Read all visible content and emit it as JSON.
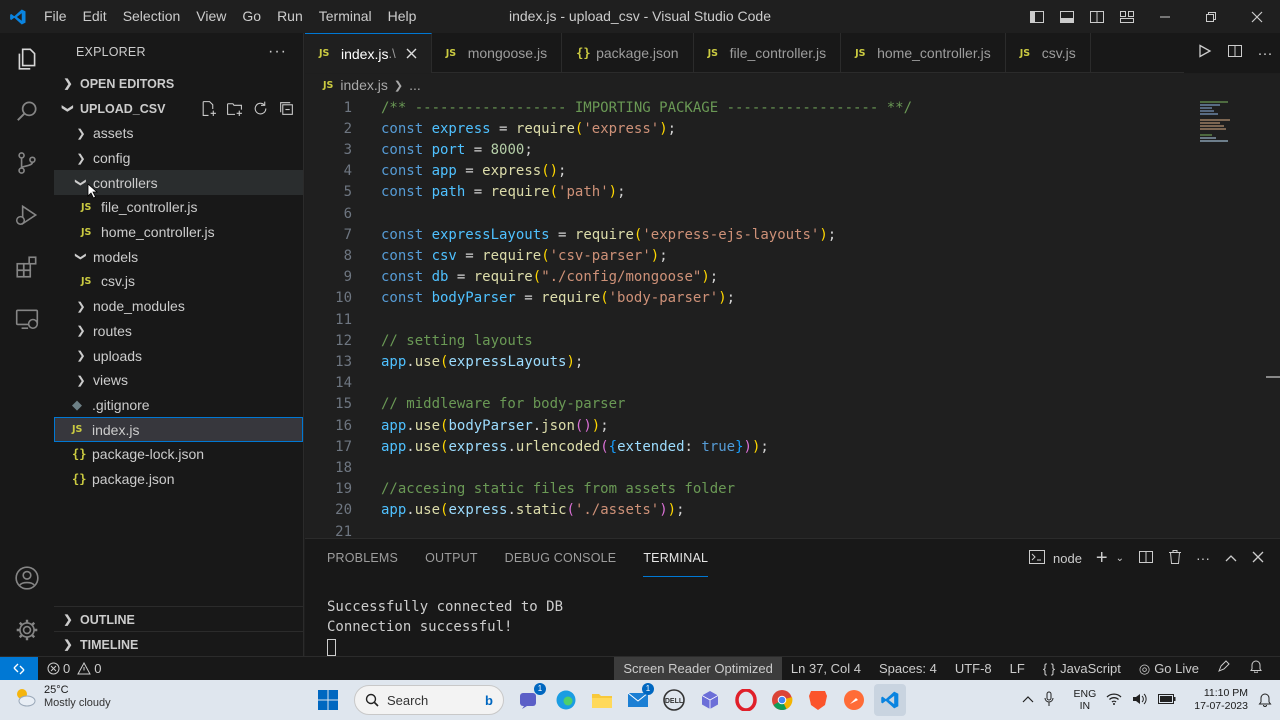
{
  "window": {
    "title": "index.js - upload_csv - Visual Studio Code",
    "menu": [
      "File",
      "Edit",
      "Selection",
      "View",
      "Go",
      "Run",
      "Terminal",
      "Help"
    ]
  },
  "explorer": {
    "header": "EXPLORER",
    "more": "···",
    "open_editors": "OPEN EDITORS",
    "project": "UPLOAD_CSV",
    "tree": [
      {
        "label": "assets",
        "type": "folder",
        "expanded": false,
        "depth": 0
      },
      {
        "label": "config",
        "type": "folder",
        "expanded": false,
        "depth": 0
      },
      {
        "label": "controllers",
        "type": "folder",
        "expanded": true,
        "depth": 0
      },
      {
        "label": "file_controller.js",
        "type": "js",
        "depth": 1
      },
      {
        "label": "home_controller.js",
        "type": "js",
        "depth": 1
      },
      {
        "label": "models",
        "type": "folder",
        "expanded": true,
        "depth": 0
      },
      {
        "label": "csv.js",
        "type": "js",
        "depth": 1
      },
      {
        "label": "node_modules",
        "type": "folder",
        "expanded": false,
        "depth": 0
      },
      {
        "label": "routes",
        "type": "folder",
        "expanded": false,
        "depth": 0
      },
      {
        "label": "uploads",
        "type": "folder",
        "expanded": false,
        "depth": 0
      },
      {
        "label": "views",
        "type": "folder",
        "expanded": false,
        "depth": 0
      },
      {
        "label": ".gitignore",
        "type": "git",
        "depth": 0
      },
      {
        "label": "index.js",
        "type": "js",
        "depth": 0,
        "selected": true
      },
      {
        "label": "package-lock.json",
        "type": "json",
        "depth": 0
      },
      {
        "label": "package.json",
        "type": "json",
        "depth": 0
      }
    ],
    "outline": "OUTLINE",
    "timeline": "TIMELINE"
  },
  "tabs": [
    {
      "label": "index.js",
      "suffix": " .\\",
      "icon": "JS",
      "active": true
    },
    {
      "label": "mongoose.js",
      "icon": "JS"
    },
    {
      "label": "package.json",
      "icon": "{}"
    },
    {
      "label": "file_controller.js",
      "icon": "JS"
    },
    {
      "label": "home_controller.js",
      "icon": "JS"
    },
    {
      "label": "csv.js",
      "icon": "JS"
    }
  ],
  "breadcrumb": {
    "file": "index.js",
    "rest": "..."
  },
  "code": [
    {
      "n": "1",
      "segs": [
        [
          "/** ------------------ IMPORTING PACKAGE ------------------ **/",
          "#6a9955"
        ]
      ]
    },
    {
      "n": "2",
      "segs": [
        [
          "const ",
          "#569cd6"
        ],
        [
          "express",
          "#4fc1ff"
        ],
        [
          " = ",
          "#d4d4d4"
        ],
        [
          "require",
          "#dcdcaa"
        ],
        [
          "(",
          "#ffd700"
        ],
        [
          "'express'",
          "#ce9178"
        ],
        [
          ")",
          "#ffd700"
        ],
        [
          ";",
          "#d4d4d4"
        ]
      ]
    },
    {
      "n": "3",
      "segs": [
        [
          "const ",
          "#569cd6"
        ],
        [
          "port",
          "#4fc1ff"
        ],
        [
          " = ",
          "#d4d4d4"
        ],
        [
          "8000",
          "#b5cea8"
        ],
        [
          ";",
          "#d4d4d4"
        ]
      ]
    },
    {
      "n": "4",
      "segs": [
        [
          "const ",
          "#569cd6"
        ],
        [
          "app",
          "#4fc1ff"
        ],
        [
          " = ",
          "#d4d4d4"
        ],
        [
          "express",
          "#dcdcaa"
        ],
        [
          "()",
          "#ffd700"
        ],
        [
          ";",
          "#d4d4d4"
        ]
      ]
    },
    {
      "n": "5",
      "segs": [
        [
          "const ",
          "#569cd6"
        ],
        [
          "path",
          "#4fc1ff"
        ],
        [
          " = ",
          "#d4d4d4"
        ],
        [
          "require",
          "#dcdcaa"
        ],
        [
          "(",
          "#ffd700"
        ],
        [
          "'path'",
          "#ce9178"
        ],
        [
          ")",
          "#ffd700"
        ],
        [
          ";",
          "#d4d4d4"
        ]
      ]
    },
    {
      "n": "6",
      "segs": []
    },
    {
      "n": "7",
      "segs": [
        [
          "const ",
          "#569cd6"
        ],
        [
          "expressLayouts",
          "#4fc1ff"
        ],
        [
          " = ",
          "#d4d4d4"
        ],
        [
          "require",
          "#dcdcaa"
        ],
        [
          "(",
          "#ffd700"
        ],
        [
          "'express-ejs-layouts'",
          "#ce9178"
        ],
        [
          ")",
          "#ffd700"
        ],
        [
          ";",
          "#d4d4d4"
        ]
      ]
    },
    {
      "n": "8",
      "segs": [
        [
          "const ",
          "#569cd6"
        ],
        [
          "csv",
          "#4fc1ff"
        ],
        [
          " = ",
          "#d4d4d4"
        ],
        [
          "require",
          "#dcdcaa"
        ],
        [
          "(",
          "#ffd700"
        ],
        [
          "'csv-parser'",
          "#ce9178"
        ],
        [
          ")",
          "#ffd700"
        ],
        [
          ";",
          "#d4d4d4"
        ]
      ]
    },
    {
      "n": "9",
      "segs": [
        [
          "const ",
          "#569cd6"
        ],
        [
          "db",
          "#4fc1ff"
        ],
        [
          " = ",
          "#d4d4d4"
        ],
        [
          "require",
          "#dcdcaa"
        ],
        [
          "(",
          "#ffd700"
        ],
        [
          "\"./config/mongoose\"",
          "#ce9178"
        ],
        [
          ")",
          "#ffd700"
        ],
        [
          ";",
          "#d4d4d4"
        ]
      ]
    },
    {
      "n": "10",
      "segs": [
        [
          "const ",
          "#569cd6"
        ],
        [
          "bodyParser",
          "#4fc1ff"
        ],
        [
          " = ",
          "#d4d4d4"
        ],
        [
          "require",
          "#dcdcaa"
        ],
        [
          "(",
          "#ffd700"
        ],
        [
          "'body-parser'",
          "#ce9178"
        ],
        [
          ")",
          "#ffd700"
        ],
        [
          ";",
          "#d4d4d4"
        ]
      ]
    },
    {
      "n": "11",
      "segs": []
    },
    {
      "n": "12",
      "segs": [
        [
          "// setting layouts",
          "#6a9955"
        ]
      ]
    },
    {
      "n": "13",
      "segs": [
        [
          "app",
          "#4fc1ff"
        ],
        [
          ".",
          "#d4d4d4"
        ],
        [
          "use",
          "#dcdcaa"
        ],
        [
          "(",
          "#ffd700"
        ],
        [
          "expressLayouts",
          "#9cdcfe"
        ],
        [
          ")",
          "#ffd700"
        ],
        [
          ";",
          "#d4d4d4"
        ]
      ]
    },
    {
      "n": "14",
      "segs": []
    },
    {
      "n": "15",
      "segs": [
        [
          "// middleware for body-parser",
          "#6a9955"
        ]
      ]
    },
    {
      "n": "16",
      "segs": [
        [
          "app",
          "#4fc1ff"
        ],
        [
          ".",
          "#d4d4d4"
        ],
        [
          "use",
          "#dcdcaa"
        ],
        [
          "(",
          "#ffd700"
        ],
        [
          "bodyParser",
          "#9cdcfe"
        ],
        [
          ".",
          "#d4d4d4"
        ],
        [
          "json",
          "#dcdcaa"
        ],
        [
          "()",
          "#da70d6"
        ],
        [
          ")",
          "#ffd700"
        ],
        [
          ";",
          "#d4d4d4"
        ]
      ]
    },
    {
      "n": "17",
      "segs": [
        [
          "app",
          "#4fc1ff"
        ],
        [
          ".",
          "#d4d4d4"
        ],
        [
          "use",
          "#dcdcaa"
        ],
        [
          "(",
          "#ffd700"
        ],
        [
          "express",
          "#9cdcfe"
        ],
        [
          ".",
          "#d4d4d4"
        ],
        [
          "urlencoded",
          "#dcdcaa"
        ],
        [
          "(",
          "#da70d6"
        ],
        [
          "{",
          "#179fff"
        ],
        [
          "extended",
          "#9cdcfe"
        ],
        [
          ": ",
          "#d4d4d4"
        ],
        [
          "true",
          "#569cd6"
        ],
        [
          "}",
          "#179fff"
        ],
        [
          ")",
          "#da70d6"
        ],
        [
          ")",
          "#ffd700"
        ],
        [
          ";",
          "#d4d4d4"
        ]
      ]
    },
    {
      "n": "18",
      "segs": []
    },
    {
      "n": "19",
      "segs": [
        [
          "//accesing static files from assets folder",
          "#6a9955"
        ]
      ]
    },
    {
      "n": "20",
      "segs": [
        [
          "app",
          "#4fc1ff"
        ],
        [
          ".",
          "#d4d4d4"
        ],
        [
          "use",
          "#dcdcaa"
        ],
        [
          "(",
          "#ffd700"
        ],
        [
          "express",
          "#9cdcfe"
        ],
        [
          ".",
          "#d4d4d4"
        ],
        [
          "static",
          "#dcdcaa"
        ],
        [
          "(",
          "#da70d6"
        ],
        [
          "'./assets'",
          "#ce9178"
        ],
        [
          ")",
          "#da70d6"
        ],
        [
          ")",
          "#ffd700"
        ],
        [
          ";",
          "#d4d4d4"
        ]
      ]
    },
    {
      "n": "21",
      "segs": []
    }
  ],
  "panel": {
    "tabs": [
      "PROBLEMS",
      "OUTPUT",
      "DEBUG CONSOLE",
      "TERMINAL"
    ],
    "active_tab": "TERMINAL",
    "shell": "node",
    "terminal_lines": [
      "Successfully connected to DB",
      "Connection successful!"
    ]
  },
  "status": {
    "errors": "0",
    "warnings": "0",
    "screen_reader": "Screen Reader Optimized",
    "position": "Ln 37, Col 4",
    "spaces": "Spaces: 4",
    "encoding": "UTF-8",
    "eol": "LF",
    "language": "JavaScript",
    "golive": "Go Live"
  },
  "taskbar": {
    "temp": "25°C",
    "weather": "Mostly cloudy",
    "search": "Search",
    "lang1": "ENG",
    "lang2": "IN",
    "time": "11:10 PM",
    "date": "17-07-2023",
    "badge1": "1",
    "badge2": "1"
  },
  "colors": {
    "accent": "#0078d4",
    "js_icon": "#cbcb41",
    "status_bg": "#181818",
    "editor_bg": "#1f1f1f"
  }
}
